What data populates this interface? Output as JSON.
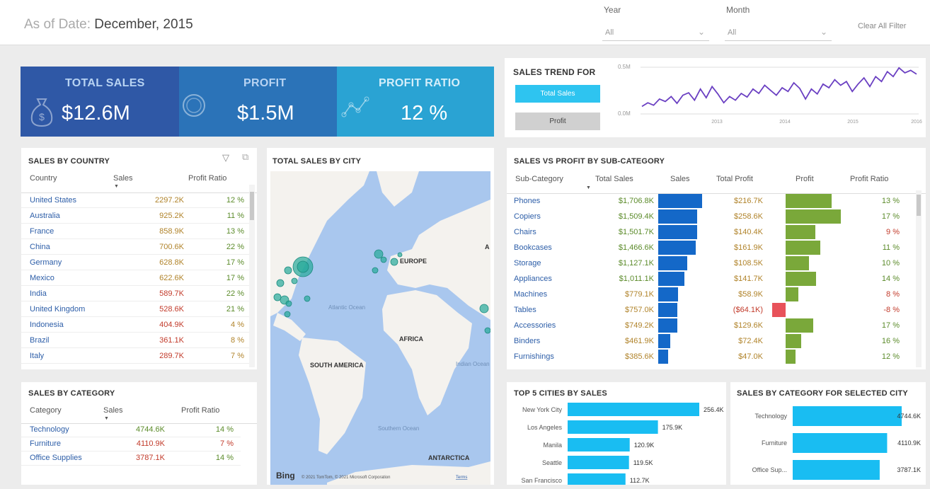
{
  "header": {
    "as_of_label": "As of Date:",
    "as_of_value": "December, 2015",
    "year_label": "Year",
    "year_value": "All",
    "month_label": "Month",
    "month_value": "All",
    "clear_filter": "Clear All Filter"
  },
  "kpis": {
    "total_sales": {
      "label": "TOTAL SALES",
      "value": "$12.6M"
    },
    "profit": {
      "label": "PROFIT",
      "value": "$1.5M"
    },
    "profit_ratio": {
      "label": "PROFIT RATIO",
      "value": "12 %"
    }
  },
  "trend": {
    "title": "SALES TREND FOR",
    "btn_sales": "Total Sales",
    "btn_profit": "Profit",
    "y_top": "0.5M",
    "y_bottom": "0.0M",
    "x_labels": [
      "2013",
      "2014",
      "2015",
      "2016"
    ],
    "values": [
      0.12,
      0.18,
      0.14,
      0.24,
      0.2,
      0.28,
      0.17,
      0.3,
      0.34,
      0.22,
      0.4,
      0.26,
      0.44,
      0.32,
      0.18,
      0.28,
      0.22,
      0.33,
      0.27,
      0.4,
      0.33,
      0.46,
      0.38,
      0.3,
      0.42,
      0.36,
      0.5,
      0.41,
      0.24,
      0.4,
      0.32,
      0.48,
      0.42,
      0.55,
      0.46,
      0.52,
      0.36,
      0.48,
      0.58,
      0.44,
      0.6,
      0.52,
      0.68,
      0.6,
      0.74,
      0.66,
      0.7,
      0.64
    ]
  },
  "country": {
    "title": "SALES BY COUNTRY",
    "cols": [
      "Country",
      "Sales",
      "Profit Ratio"
    ],
    "rows": [
      {
        "name": "United States",
        "sales": "2297.2K",
        "ratio": "12 %"
      },
      {
        "name": "Australia",
        "sales": "925.2K",
        "ratio": "11 %"
      },
      {
        "name": "France",
        "sales": "858.9K",
        "ratio": "13 %"
      },
      {
        "name": "China",
        "sales": "700.6K",
        "ratio": "22 %"
      },
      {
        "name": "Germany",
        "sales": "628.8K",
        "ratio": "17 %"
      },
      {
        "name": "Mexico",
        "sales": "622.6K",
        "ratio": "17 %"
      },
      {
        "name": "India",
        "sales": "589.7K",
        "ratio": "22 %"
      },
      {
        "name": "United Kingdom",
        "sales": "528.6K",
        "ratio": "21 %"
      },
      {
        "name": "Indonesia",
        "sales": "404.9K",
        "ratio": "4 %"
      },
      {
        "name": "Brazil",
        "sales": "361.1K",
        "ratio": "8 %"
      },
      {
        "name": "Italy",
        "sales": "289.7K",
        "ratio": "7 %"
      }
    ]
  },
  "category": {
    "title": "SALES BY CATEGORY",
    "cols": [
      "Category",
      "Sales",
      "Profit Ratio"
    ],
    "rows": [
      {
        "name": "Technology",
        "sales": "4744.6K",
        "ratio": "14 %"
      },
      {
        "name": "Furniture",
        "sales": "4110.9K",
        "ratio": "7 %"
      },
      {
        "name": "Office Supplies",
        "sales": "3787.1K",
        "ratio": "14 %"
      }
    ]
  },
  "map": {
    "title": "TOTAL SALES BY CITY",
    "labels": {
      "europe": "EUROPE",
      "africa": "AFRICA",
      "south_america": "SOUTH AMERICA",
      "antarctica": "ANTARCTICA",
      "atlantic": "Atlantic Ocean",
      "indian": "Indian Ocean",
      "southern": "Southern Ocean"
    },
    "bing": "Bing",
    "copyright": "© 2021 TomTom, © 2021 Microsoft Corporation",
    "terms": "Terms"
  },
  "subcat": {
    "title": "SALES VS PROFIT BY SUB-CATEGORY",
    "cols": [
      "Sub-Category",
      "Total Sales",
      "Sales",
      "Total Profit",
      "Profit",
      "Profit Ratio"
    ],
    "rows": [
      {
        "name": "Phones",
        "sales": "$1,706.8K",
        "sales_v": 1706.8,
        "profit": "$216.7K",
        "profit_v": 216.7,
        "ratio": "13 %"
      },
      {
        "name": "Copiers",
        "sales": "$1,509.4K",
        "sales_v": 1509.4,
        "profit": "$258.6K",
        "profit_v": 258.6,
        "ratio": "17 %"
      },
      {
        "name": "Chairs",
        "sales": "$1,501.7K",
        "sales_v": 1501.7,
        "profit": "$140.4K",
        "profit_v": 140.4,
        "ratio": "9 %"
      },
      {
        "name": "Bookcases",
        "sales": "$1,466.6K",
        "sales_v": 1466.6,
        "profit": "$161.9K",
        "profit_v": 161.9,
        "ratio": "11 %"
      },
      {
        "name": "Storage",
        "sales": "$1,127.1K",
        "sales_v": 1127.1,
        "profit": "$108.5K",
        "profit_v": 108.5,
        "ratio": "10 %"
      },
      {
        "name": "Appliances",
        "sales": "$1,011.1K",
        "sales_v": 1011.1,
        "profit": "$141.7K",
        "profit_v": 141.7,
        "ratio": "14 %"
      },
      {
        "name": "Machines",
        "sales": "$779.1K",
        "sales_v": 779.1,
        "profit": "$58.9K",
        "profit_v": 58.9,
        "ratio": "8 %"
      },
      {
        "name": "Tables",
        "sales": "$757.0K",
        "sales_v": 757.0,
        "profit": "($64.1K)",
        "profit_v": -64.1,
        "ratio": "-8 %"
      },
      {
        "name": "Accessories",
        "sales": "$749.2K",
        "sales_v": 749.2,
        "profit": "$129.6K",
        "profit_v": 129.6,
        "ratio": "17 %"
      },
      {
        "name": "Binders",
        "sales": "$461.9K",
        "sales_v": 461.9,
        "profit": "$72.4K",
        "profit_v": 72.4,
        "ratio": "16 %"
      },
      {
        "name": "Furnishings",
        "sales": "$385.6K",
        "sales_v": 385.6,
        "profit": "$47.0K",
        "profit_v": 47.0,
        "ratio": "12 %"
      }
    ]
  },
  "top_cities": {
    "title": "TOP 5 CITIES BY SALES",
    "rows": [
      {
        "name": "New York City",
        "value": 256.4,
        "label": "256.4K"
      },
      {
        "name": "Los Angeles",
        "value": 175.9,
        "label": "175.9K"
      },
      {
        "name": "Manila",
        "value": 120.9,
        "label": "120.9K"
      },
      {
        "name": "Seattle",
        "value": 119.5,
        "label": "119.5K"
      },
      {
        "name": "San Francisco",
        "value": 112.7,
        "label": "112.7K"
      }
    ]
  },
  "city_category": {
    "title": "SALES BY CATEGORY FOR SELECTED CITY",
    "rows": [
      {
        "name": "Technology",
        "value": 4744.6,
        "label": "4744.6K"
      },
      {
        "name": "Furniture",
        "value": 4110.9,
        "label": "4110.9K"
      },
      {
        "name": "Office Sup...",
        "value": 3787.1,
        "label": "3787.1K"
      }
    ]
  },
  "colors": {
    "kpi1": "#2f58a6",
    "kpi2": "#2b73b8",
    "kpi3": "#2aa3d3",
    "trend_line": "#6a3fc2",
    "btn_sales": "#2ec4f0",
    "bar_sales": "#1468c8",
    "bar_profit": "#7aa83a",
    "bar_neg": "#e8525a",
    "city_bar": "#19bdf2",
    "map_water": "#a9c7ee",
    "map_land": "#f4f2ee",
    "bubble": "#25a99a"
  }
}
